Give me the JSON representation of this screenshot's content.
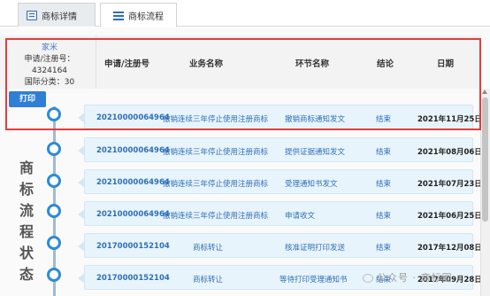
{
  "tabs": [
    {
      "label": "商标详情",
      "icon": "document-icon",
      "active": false
    },
    {
      "label": "商标流程",
      "icon": "list-icon",
      "active": true
    }
  ],
  "trademark": {
    "name": "家米",
    "reg_label": "申请/注册号：4324164",
    "class_label": "国际分类：30"
  },
  "table_headers": {
    "reg_no": "申请/注册号",
    "business": "业务名称",
    "step": "环节名称",
    "result": "结论",
    "date": "日期"
  },
  "print_label": "打印",
  "side_label": "商标流程状态",
  "rows": [
    {
      "reg_no": "20210000064964",
      "business": "撤销连续三年停止使用注册商标",
      "step": "撤销商标通知发文",
      "result": "结束",
      "date": "2021年11月25日"
    },
    {
      "reg_no": "20210000064964",
      "business": "撤销连续三年停止使用注册商标",
      "step": "提供证据通知发文",
      "result": "结束",
      "date": "2021年08月06日"
    },
    {
      "reg_no": "20210000064964",
      "business": "撤销连续三年停止使用注册商标",
      "step": "受理通知书发文",
      "result": "结束",
      "date": "2021年07月23日"
    },
    {
      "reg_no": "20210000064964",
      "business": "撤销连续三年停止使用注册商标",
      "step": "申请收文",
      "result": "结束",
      "date": "2021年06月25日"
    },
    {
      "reg_no": "20170000152104",
      "business": "商标转让",
      "step": "核准证明打印发送",
      "result": "结束",
      "date": "2017年12月08日"
    },
    {
      "reg_no": "20170000152104",
      "business": "商标转让",
      "step": "等待打印受理通知书",
      "result": "结束",
      "date": "2017年09月28日"
    }
  ],
  "watermark": "公众号 · 商标圈",
  "colors": {
    "accent": "#2f7fd6",
    "highlight_border": "#e23c3c",
    "row_bg": "#e8f4fb"
  }
}
